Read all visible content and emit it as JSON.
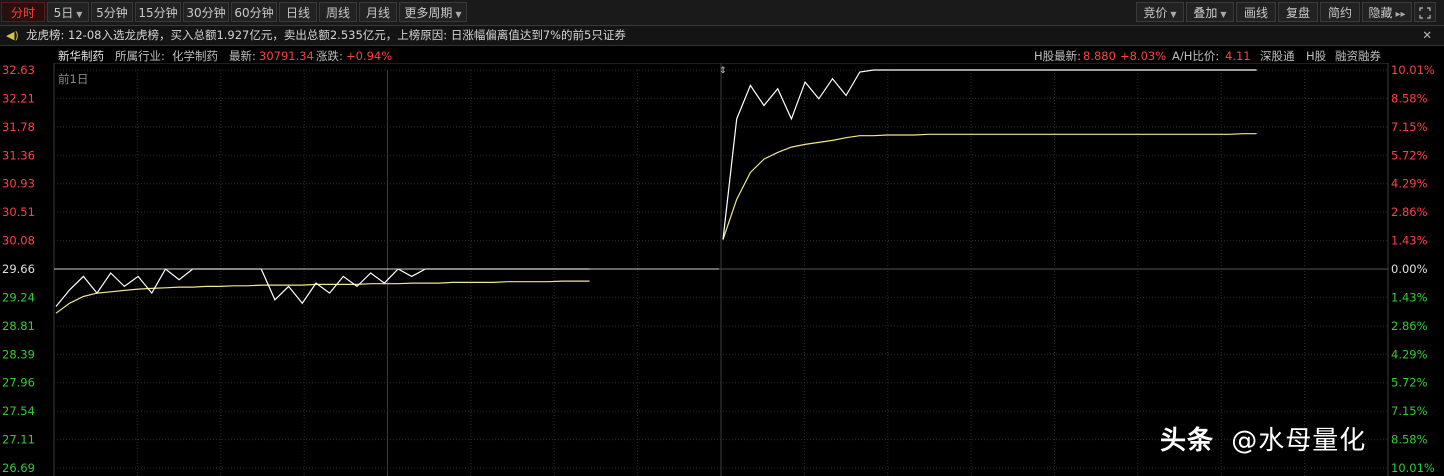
{
  "toolbar": {
    "left": [
      {
        "label": "分时",
        "active": true,
        "dropdown": false
      },
      {
        "label": "5日",
        "active": false,
        "dropdown": true
      },
      {
        "label": "5分钟",
        "active": false,
        "dropdown": false
      },
      {
        "label": "15分钟",
        "active": false,
        "dropdown": false
      },
      {
        "label": "30分钟",
        "active": false,
        "dropdown": false
      },
      {
        "label": "60分钟",
        "active": false,
        "dropdown": false
      },
      {
        "label": "日线",
        "active": false,
        "dropdown": false
      },
      {
        "label": "周线",
        "active": false,
        "dropdown": false
      },
      {
        "label": "月线",
        "active": false,
        "dropdown": false
      },
      {
        "label": "更多周期",
        "active": false,
        "dropdown": true
      }
    ],
    "right": [
      {
        "label": "竞价",
        "dropdown": true
      },
      {
        "label": "叠加",
        "dropdown": true
      },
      {
        "label": "画线",
        "dropdown": false
      },
      {
        "label": "复盘",
        "dropdown": false
      },
      {
        "label": "简约",
        "dropdown": false
      },
      {
        "label": "隐藏",
        "dropdown": false
      }
    ],
    "hide_arrows": "▸▸",
    "fullscreen_icon": "fullscreen-icon"
  },
  "infobar": {
    "text": "龙虎榜: 12-08入选龙虎榜，买入总额1.927亿元，卖出总额2.535亿元，上榜原因: 日涨幅偏离值达到7%的前5只证券",
    "close": "✕"
  },
  "header": {
    "name": "新华制药",
    "industry_label": "所属行业:",
    "industry": "化学制药",
    "latest_label": "最新:",
    "latest": "30791.34",
    "change_label": "涨跌:",
    "change": "+0.94%",
    "h_latest_label": "H股最新:",
    "h_latest": "8.880",
    "h_change": "+8.03%",
    "ah_label": "A/H比价:",
    "ah_value": "4.11",
    "links": [
      "深股通",
      "H股",
      "融资融券"
    ]
  },
  "chart_label": "前1日",
  "colors": {
    "price_line": "#ffffff",
    "avg_line": "#f0e68c",
    "up": "#ff4040",
    "down": "#33cc33",
    "flat": "#e0e0e0",
    "grid": "#2b2b2b",
    "grid_vertical": "#3c3c3c"
  },
  "chart_data": {
    "type": "line",
    "y_left_ticks": [
      "32.63",
      "32.21",
      "31.78",
      "31.36",
      "30.93",
      "30.51",
      "30.08",
      "29.66",
      "29.24",
      "28.81",
      "28.39",
      "27.96",
      "27.54",
      "27.11",
      "26.69"
    ],
    "y_right_ticks": [
      "10.01%",
      "8.58%",
      "7.15%",
      "5.72%",
      "4.29%",
      "2.86%",
      "1.43%",
      "0.00%",
      "1.43%",
      "2.86%",
      "4.29%",
      "5.72%",
      "7.15%",
      "8.58%",
      "10.01%"
    ],
    "ylim": [
      26.69,
      32.63
    ],
    "prev_close": 29.66,
    "series": [
      {
        "day": 1,
        "price": [
          29.1,
          29.35,
          29.55,
          29.3,
          29.6,
          29.4,
          29.55,
          29.3,
          29.66,
          29.5,
          29.66,
          29.66,
          29.66,
          29.66,
          29.66,
          29.66,
          29.2,
          29.4,
          29.15,
          29.45,
          29.3,
          29.55,
          29.4,
          29.6,
          29.45,
          29.66,
          29.55,
          29.66,
          29.66,
          29.66,
          29.66,
          29.66,
          29.66,
          29.66,
          29.66,
          29.66,
          29.66,
          29.66,
          29.66,
          29.66
        ],
        "avg": [
          29.0,
          29.15,
          29.25,
          29.3,
          29.32,
          29.34,
          29.36,
          29.37,
          29.38,
          29.39,
          29.39,
          29.4,
          29.4,
          29.41,
          29.41,
          29.42,
          29.42,
          29.42,
          29.42,
          29.43,
          29.43,
          29.43,
          29.43,
          29.44,
          29.44,
          29.44,
          29.45,
          29.45,
          29.45,
          29.46,
          29.46,
          29.46,
          29.46,
          29.47,
          29.47,
          29.47,
          29.47,
          29.48,
          29.48,
          29.48
        ]
      },
      {
        "day": 2,
        "price": [
          30.1,
          31.9,
          32.4,
          32.1,
          32.35,
          31.9,
          32.45,
          32.2,
          32.5,
          32.25,
          32.6,
          32.63,
          32.63,
          32.63,
          32.63,
          32.63,
          32.63,
          32.63,
          32.63,
          32.63,
          32.63,
          32.63,
          32.63,
          32.63,
          32.63,
          32.63,
          32.63,
          32.63,
          32.63,
          32.63,
          32.63,
          32.63,
          32.63,
          32.63,
          32.63,
          32.63,
          32.63,
          32.63,
          32.63,
          32.63
        ],
        "avg": [
          30.1,
          30.7,
          31.1,
          31.3,
          31.4,
          31.48,
          31.52,
          31.55,
          31.58,
          31.62,
          31.65,
          31.65,
          31.66,
          31.66,
          31.66,
          31.67,
          31.67,
          31.67,
          31.67,
          31.67,
          31.67,
          31.67,
          31.67,
          31.67,
          31.67,
          31.67,
          31.67,
          31.67,
          31.67,
          31.67,
          31.67,
          31.67,
          31.67,
          31.67,
          31.67,
          31.67,
          31.67,
          31.67,
          31.68,
          31.68
        ]
      }
    ]
  },
  "watermark": {
    "prefix": "头条",
    "text": "@水母量化"
  }
}
